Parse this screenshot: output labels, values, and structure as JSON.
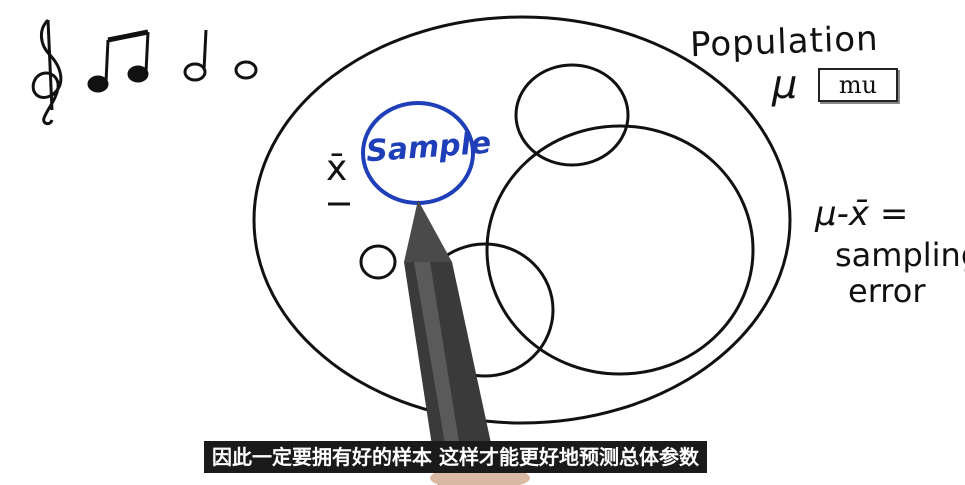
{
  "labels": {
    "population": "Population",
    "mu_symbol": "μ",
    "mu_box": "mu",
    "x_bar": "x̄",
    "sample": "Sample",
    "formula": "μ-x̄ =",
    "sampling": "sampling",
    "error": "error"
  },
  "subtitle": "因此一定要拥有好的样本 这样才能更好地预测总体参数",
  "colors": {
    "ink": "#111111",
    "sample_blue": "#1f3fb8",
    "subtitle_bg": "#1a1a1a",
    "subtitle_text": "#ffffff"
  },
  "icons": [
    "treble-clef-icon",
    "eighth-notes-icon",
    "half-note-icon",
    "whole-note-icon",
    "pen-icon"
  ]
}
